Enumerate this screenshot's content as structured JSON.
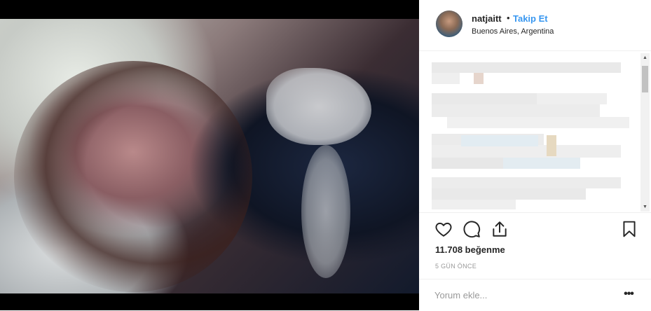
{
  "post": {
    "username": "natjaitt",
    "separator": "•",
    "follow_label": "Takip Et",
    "location": "Buenos Aires, Argentina",
    "likes_text": "11.708 beğenme",
    "time_ago": "5 GÜN ÖNCE"
  },
  "comment": {
    "placeholder": "Yorum ekle...",
    "more_label": "•••"
  },
  "icons": {
    "like": "heart-icon",
    "comment": "comment-bubble-icon",
    "share": "share-icon",
    "save": "bookmark-icon"
  },
  "colors": {
    "accent": "#3897f0",
    "text": "#262626",
    "muted": "#999999",
    "border": "#efefef"
  }
}
